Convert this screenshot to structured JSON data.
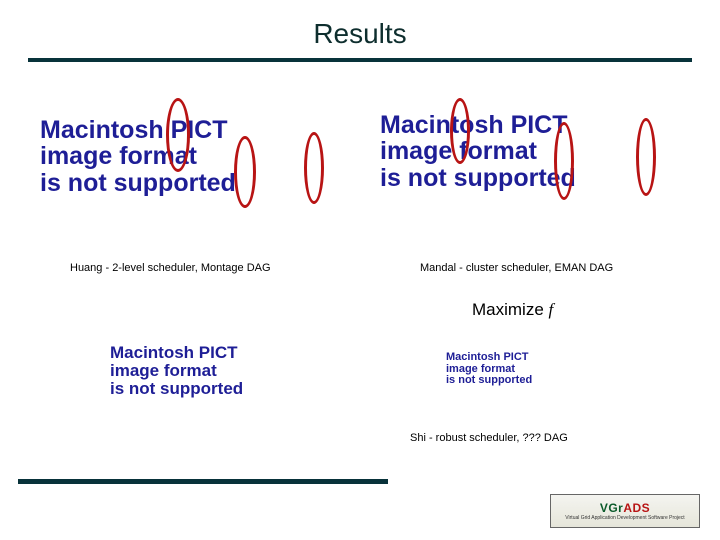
{
  "title": "Results",
  "pict_placeholder": {
    "line1": "Macintosh PICT",
    "line2": "image format",
    "line3": "is not supported"
  },
  "captions": {
    "huang": "Huang - 2-level scheduler, Montage DAG",
    "mandal": "Mandal - cluster scheduler, EMAN DAG",
    "shi": "Shi - robust scheduler, ??? DAG"
  },
  "maximize": {
    "word": "Maximize",
    "symbol": "f"
  },
  "logo": {
    "brand_pre": "VGr",
    "brand_accent": "ADS",
    "tagline": "Virtual Grid Application Development Software Project"
  }
}
